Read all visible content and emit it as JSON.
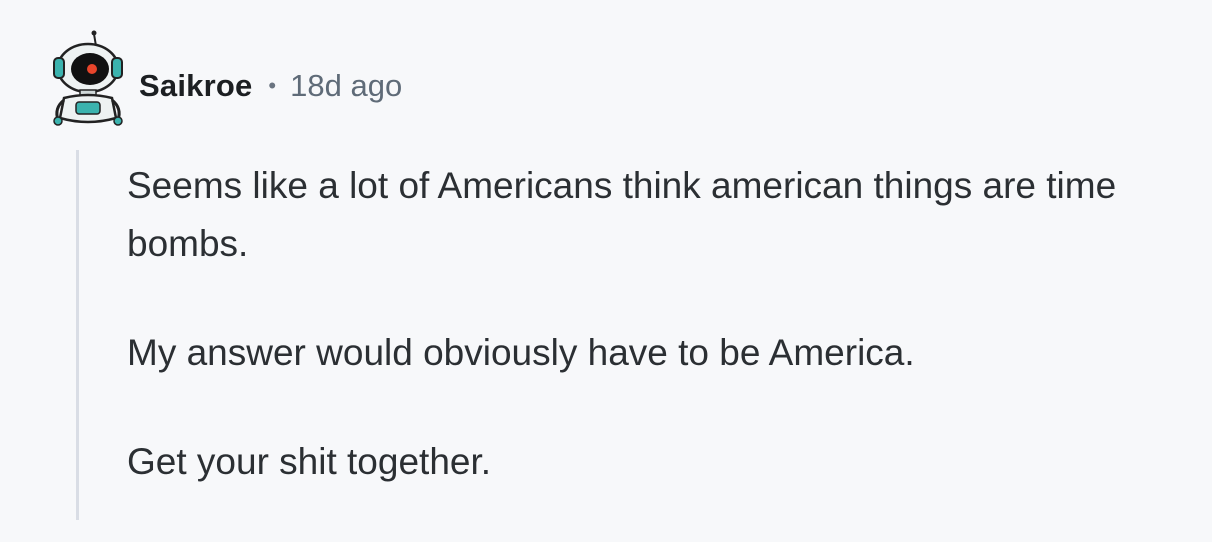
{
  "comment": {
    "author": "Saikroe",
    "separator": "•",
    "timestamp": "18d ago",
    "avatar_icon": "robot-avatar-icon",
    "paragraphs": [
      "Seems like a lot of Americans think american things are time bombs.",
      "My answer would obviously have to be America.",
      "Get your shit together."
    ]
  },
  "colors": {
    "background": "#f7f8fa",
    "thread_line": "#d9dde5",
    "avatar_accent": "#3bb3ae",
    "avatar_eye": "#e8452b"
  }
}
